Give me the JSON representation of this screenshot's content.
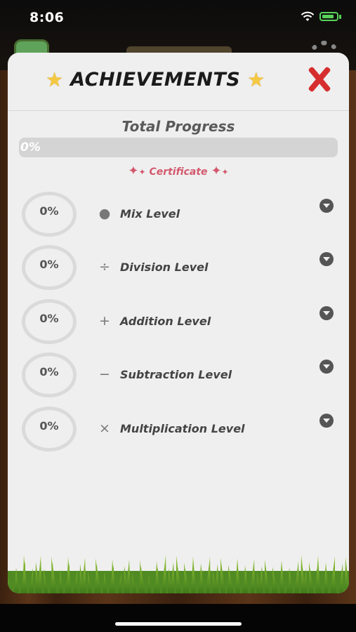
{
  "status_bar": {
    "time": "8:06"
  },
  "modal": {
    "title": "ACHIEVEMENTS",
    "total_progress_label": "Total Progress",
    "total_progress_text": "0%",
    "total_progress_value": 0,
    "certificate_label": "Certificate"
  },
  "levels": [
    {
      "label": "Mix Level",
      "percent": "0%",
      "icon": "circle-icon",
      "glyph": "●"
    },
    {
      "label": "Division Level",
      "percent": "0%",
      "icon": "division-icon",
      "glyph": "÷"
    },
    {
      "label": "Addition Level",
      "percent": "0%",
      "icon": "plus-icon",
      "glyph": "+"
    },
    {
      "label": "Subtraction Level",
      "percent": "0%",
      "icon": "minus-icon",
      "glyph": "−"
    },
    {
      "label": "Multiplication Level",
      "percent": "0%",
      "icon": "multiply-icon",
      "glyph": "×"
    }
  ],
  "colors": {
    "accent": "#d62e2e",
    "certificate": "#d3596e",
    "star": "#f5c842"
  }
}
